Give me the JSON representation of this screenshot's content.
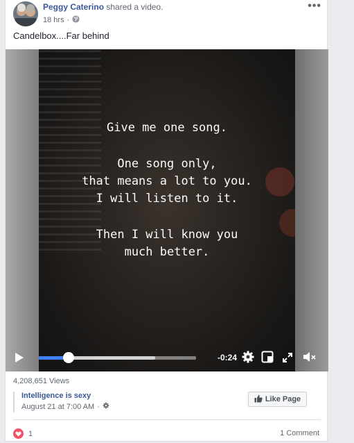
{
  "post": {
    "author": "Peggy Caterino",
    "action": "shared a video.",
    "time": "18 hrs",
    "separator": "·",
    "more": "•••",
    "caption": "Candelbox....Far behind"
  },
  "video": {
    "quote_lines": [
      "Give me one song.",
      "One song only,",
      "that means a lot to you.",
      "I will listen to it.",
      "Then I will know you",
      "much better."
    ],
    "time_remaining": "-0:24",
    "progress_played": 0.19,
    "progress_buffered": 0.74
  },
  "stats": {
    "views": "4,208,651 Views"
  },
  "page": {
    "name": "Intelligence is sexy",
    "date": "August 21 at 7:00 AM",
    "separator": "·",
    "like_label": "Like Page"
  },
  "footer": {
    "reaction_count": "1",
    "comments": "1 Comment"
  },
  "colors": {
    "link": "#385898",
    "progress": "#4080ff",
    "heart": "#f25268"
  }
}
